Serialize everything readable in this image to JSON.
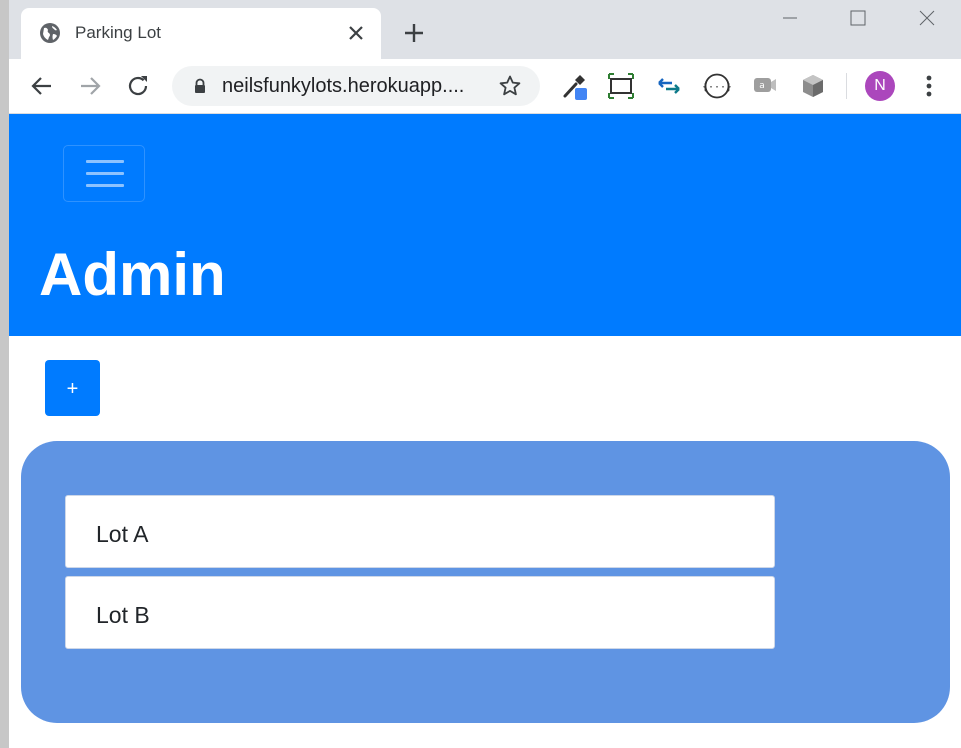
{
  "browser": {
    "tab": {
      "title": "Parking Lot",
      "favicon": "globe-icon"
    },
    "address_bar": {
      "url": "neilsfunkylots.herokuapp...."
    },
    "profile": {
      "initial": "N",
      "color": "#ab47bc"
    }
  },
  "page": {
    "navbar_color": "#007bff",
    "title": "Admin",
    "add_button_label": "+",
    "lots_panel_color": "#5f94e3",
    "lots": [
      {
        "name": "Lot A"
      },
      {
        "name": "Lot B"
      }
    ]
  }
}
